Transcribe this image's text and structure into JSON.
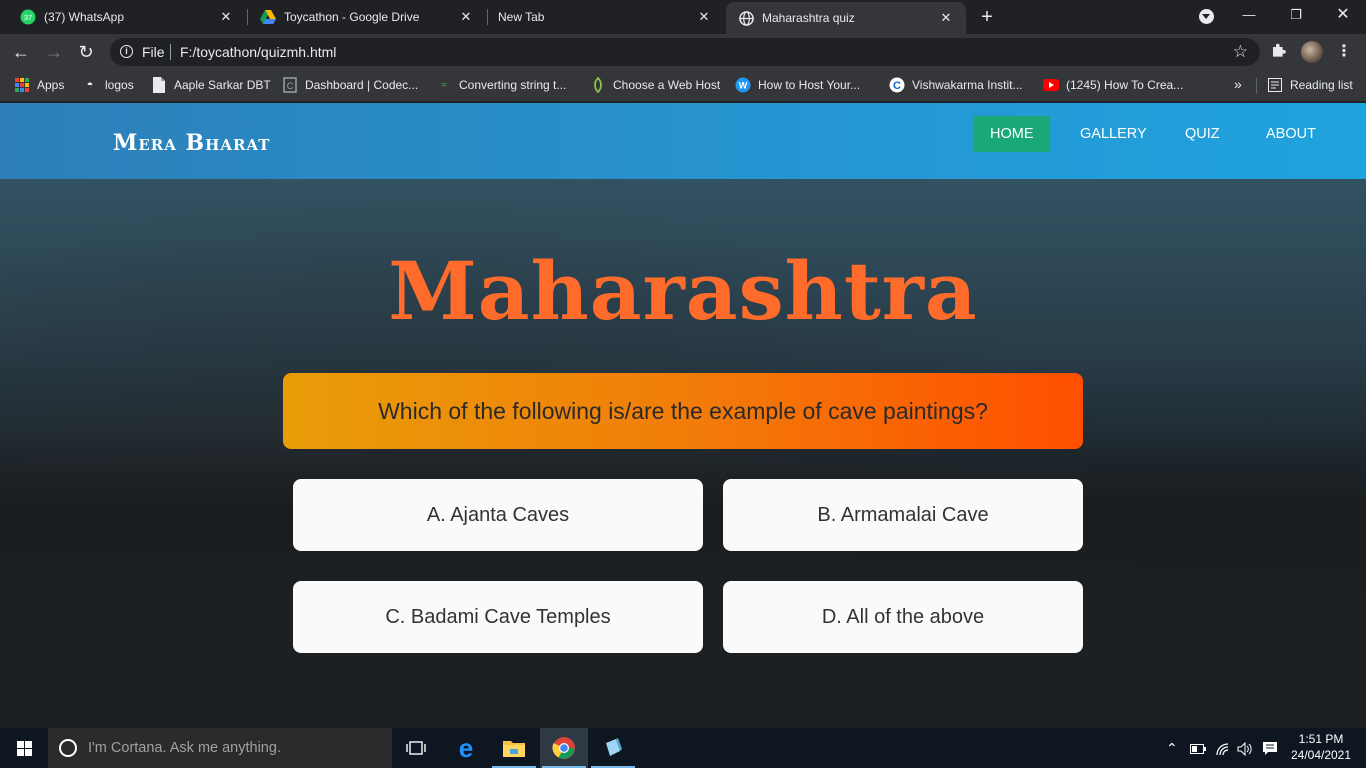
{
  "browser": {
    "tabs": [
      {
        "title": "(37) WhatsApp",
        "badge": "37"
      },
      {
        "title": "Toycathon - Google Drive"
      },
      {
        "title": "New Tab"
      },
      {
        "title": "Maharashtra quiz"
      }
    ],
    "address": {
      "scheme_label": "File",
      "url": "F:/toycathon/quizmh.html"
    },
    "bookmarks": [
      {
        "label": "Apps"
      },
      {
        "label": "logos"
      },
      {
        "label": "Aaple Sarkar DBT"
      },
      {
        "label": "Dashboard | Codec..."
      },
      {
        "label": "Converting string t..."
      },
      {
        "label": "Choose a Web Host"
      },
      {
        "label": "How to Host Your..."
      },
      {
        "label": "Vishwakarma Instit..."
      },
      {
        "label": "(1245) How To Crea..."
      }
    ],
    "overflow_label": "»",
    "reading_list_label": "Reading list"
  },
  "site": {
    "brand": "Mera Bharat",
    "nav": [
      {
        "label": "HOME"
      },
      {
        "label": "GALLERY"
      },
      {
        "label": "QUIZ"
      },
      {
        "label": "ABOUT"
      }
    ],
    "accent_color": "#1aa879"
  },
  "quiz": {
    "title": "Maharashtra",
    "question": "Which of the following is/are the example of cave paintings?",
    "answers": [
      "A. Ajanta Caves",
      "B. Armamalai Cave",
      "C. Badami Cave Temples",
      "D. All of the above"
    ]
  },
  "taskbar": {
    "search_placeholder": "I'm Cortana. Ask me anything.",
    "time": "1:51 PM",
    "date": "24/04/2021"
  }
}
